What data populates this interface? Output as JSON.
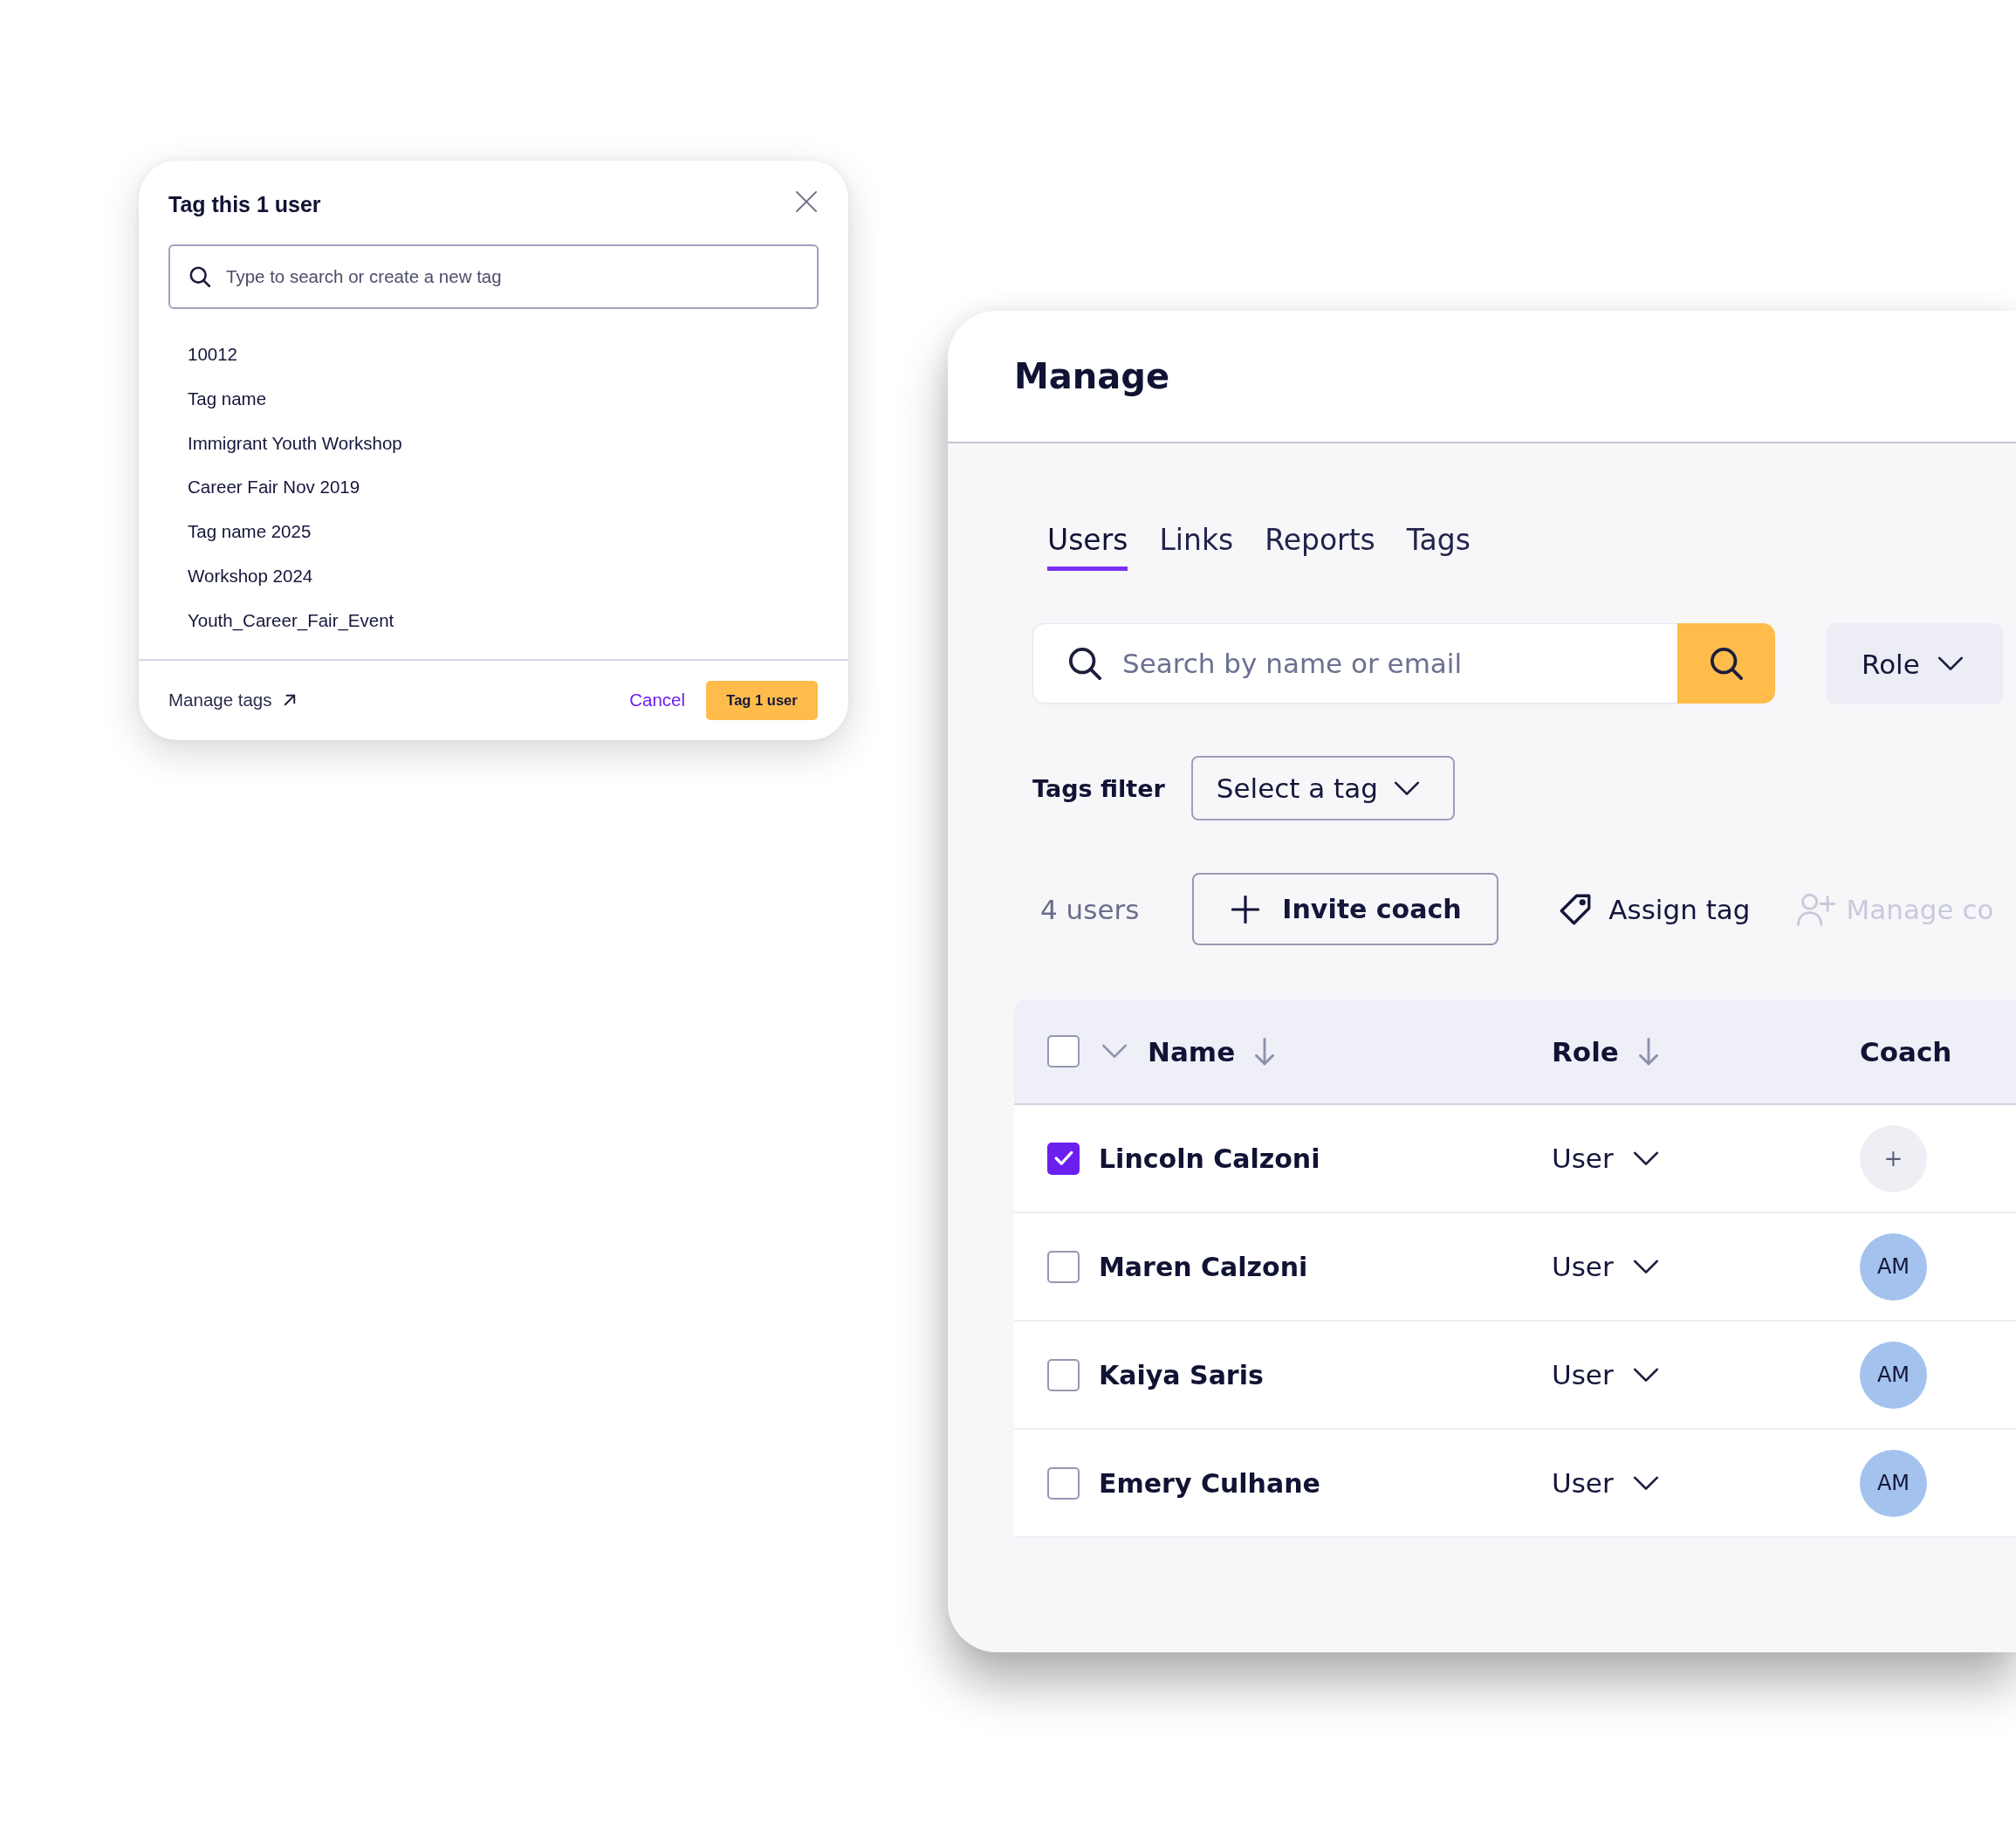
{
  "tag_dialog": {
    "title": "Tag this 1 user",
    "search": {
      "placeholder": "Type to search or create a new tag"
    },
    "tags": [
      "10012",
      "Tag name",
      "Immigrant Youth Workshop",
      "Career Fair Nov 2019",
      "Tag name 2025",
      "Workshop 2024",
      "Youth_Career_Fair_Event"
    ],
    "manage_link": "Manage tags",
    "buttons": [
      {
        "label": "Cancel",
        "kind": "link"
      },
      {
        "label": "Tag 1 user",
        "kind": "primary"
      }
    ]
  },
  "manage_panel": {
    "title": "Manage",
    "tabs": [
      {
        "label": "Users",
        "selected": true
      },
      {
        "label": "Links",
        "selected": false
      },
      {
        "label": "Reports",
        "selected": false
      },
      {
        "label": "Tags",
        "selected": false
      }
    ],
    "search": {
      "placeholder": "Search by name or email"
    },
    "role_filter": "Role",
    "tags_filter": {
      "label": "Tags filter",
      "select_text": "Select a tag"
    },
    "user_count": "4 users",
    "actions": [
      {
        "label": "Invite coach",
        "kind": "outlined",
        "disabled": false
      },
      {
        "label": "Assign tag",
        "kind": "plain",
        "disabled": false
      },
      {
        "label": "Manage co",
        "kind": "plain",
        "disabled": true
      }
    ],
    "table": {
      "select_all_checked": false,
      "columns": [
        {
          "label": "Name",
          "sortable": true
        },
        {
          "label": "Role",
          "sortable": true
        },
        {
          "label": "Coach",
          "sortable": false
        }
      ],
      "rows": [
        {
          "name": "Lincoln Calzoni",
          "checked": true,
          "role": "User",
          "coach": {
            "kind": "add",
            "text": "+"
          }
        },
        {
          "name": "Maren Calzoni",
          "checked": false,
          "role": "User",
          "coach": {
            "kind": "avatar",
            "text": "AM"
          }
        },
        {
          "name": "Kaiya Saris",
          "checked": false,
          "role": "User",
          "coach": {
            "kind": "avatar",
            "text": "AM"
          }
        },
        {
          "name": "Emery Culhane",
          "checked": false,
          "role": "User",
          "coach": {
            "kind": "avatar",
            "text": "AM"
          }
        }
      ]
    }
  }
}
